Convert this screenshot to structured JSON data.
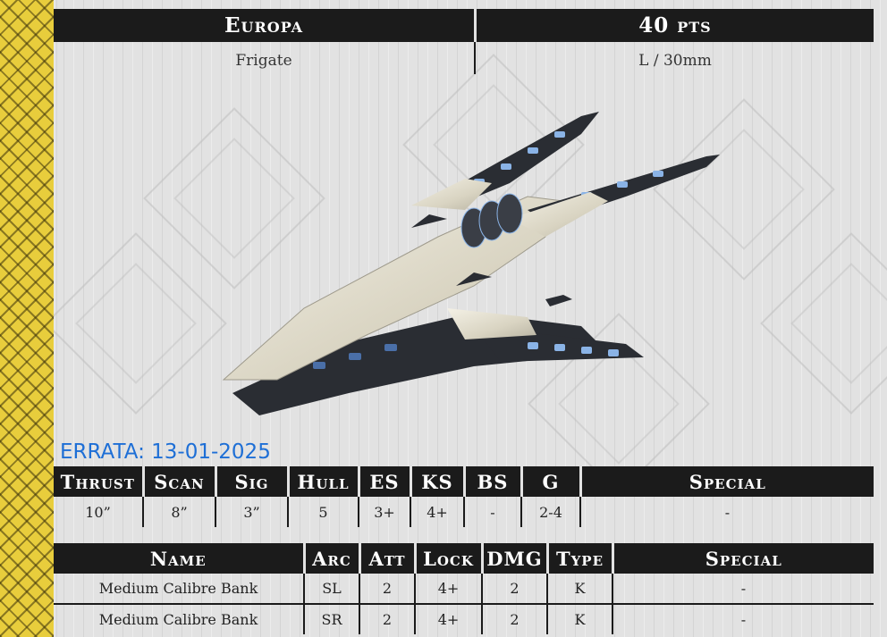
{
  "header": {
    "name": "Europa",
    "points": "40 pts",
    "class": "Frigate",
    "size": "L / 30mm"
  },
  "errata": "ERRATA: 13-01-2025",
  "stats": {
    "headers": [
      "Thrust",
      "Scan",
      "Sig",
      "Hull",
      "ES",
      "KS",
      "BS",
      "G",
      "Special"
    ],
    "values": [
      "10”",
      "8”",
      "3”",
      "5",
      "3+",
      "4+",
      "-",
      "2-4",
      "-"
    ]
  },
  "weapons": {
    "headers": [
      "Name",
      "Arc",
      "Att",
      "Lock",
      "DMG",
      "Type",
      "Special"
    ],
    "rows": [
      [
        "Medium Calibre Bank",
        "SL",
        "2",
        "4+",
        "2",
        "K",
        "-"
      ],
      [
        "Medium Calibre Bank",
        "SR",
        "2",
        "4+",
        "2",
        "K",
        "-"
      ]
    ]
  },
  "colors": {
    "header_bg": "#1b1b1b",
    "strip": "#e8cd3c",
    "errata": "#1e6fd6"
  }
}
